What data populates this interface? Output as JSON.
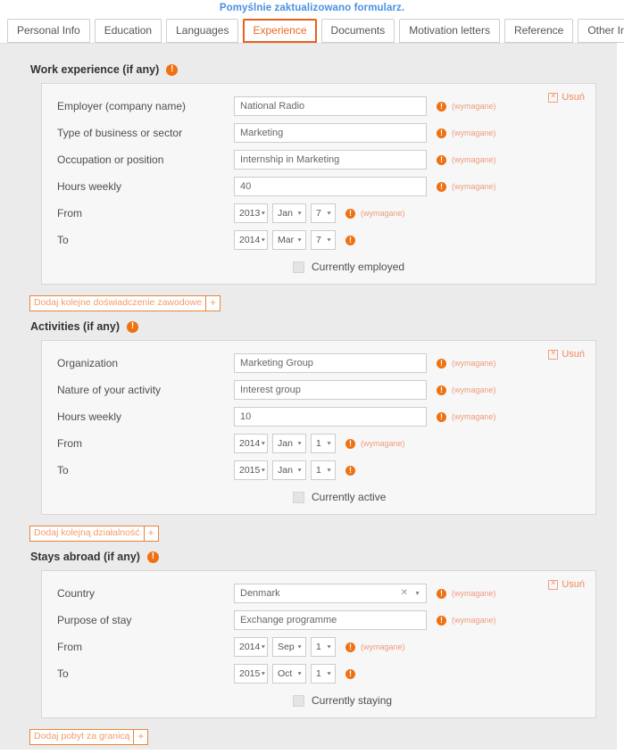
{
  "flash": {
    "message": "Pomyślnie zaktualizowano formularz."
  },
  "tabs": [
    {
      "label": "Personal Info",
      "active": false
    },
    {
      "label": "Education",
      "active": false
    },
    {
      "label": "Languages",
      "active": false
    },
    {
      "label": "Experience",
      "active": true
    },
    {
      "label": "Documents",
      "active": false
    },
    {
      "label": "Motivation letters",
      "active": false
    },
    {
      "label": "Reference",
      "active": false
    },
    {
      "label": "Other Info",
      "active": false
    }
  ],
  "common": {
    "required_text": "(wymagane)",
    "delete_label": "Usuń",
    "delete_icon": "close-box-icon",
    "info_icon": "info-icon",
    "caret_icon": "chevron-down-icon",
    "clear_icon": "clear-x-icon",
    "plus_icon": "plus-icon",
    "accent_color": "#ee7112",
    "flash_color": "#4a90e2",
    "required_color": "#f09a7a"
  },
  "sections": {
    "work": {
      "title": "Work experience (if any)",
      "fields": {
        "employer_label": "Employer (company name)",
        "employer_value": "National Radio",
        "sector_label": "Type of business or sector",
        "sector_value": "Marketing",
        "occupation_label": "Occupation or position",
        "occupation_value": "Internship in Marketing",
        "hours_label": "Hours weekly",
        "hours_value": "40",
        "from_label": "From",
        "from_year": "2013",
        "from_month": "Jan",
        "from_day": "7",
        "to_label": "To",
        "to_year": "2014",
        "to_month": "Mar",
        "to_day": "7",
        "checkbox_label": "Currently employed"
      },
      "add_button": "Dodaj kolejne doświadczenie zawodowe"
    },
    "activities": {
      "title": "Activities (if any)",
      "fields": {
        "organization_label": "Organization",
        "organization_value": "Marketing Group",
        "nature_label": "Nature of your activity",
        "nature_value": "Interest group",
        "hours_label": "Hours weekly",
        "hours_value": "10",
        "from_label": "From",
        "from_year": "2014",
        "from_month": "Jan",
        "from_day": "1",
        "to_label": "To",
        "to_year": "2015",
        "to_month": "Jan",
        "to_day": "1",
        "checkbox_label": "Currently active"
      },
      "add_button": "Dodaj kolejną działalność"
    },
    "stays": {
      "title": "Stays abroad (if any)",
      "fields": {
        "country_label": "Country",
        "country_value": "Denmark",
        "purpose_label": "Purpose of stay",
        "purpose_value": "Exchange programme",
        "from_label": "From",
        "from_year": "2014",
        "from_month": "Sep",
        "from_day": "1",
        "to_label": "To",
        "to_year": "2015",
        "to_month": "Oct",
        "to_day": "1",
        "checkbox_label": "Currently staying"
      },
      "add_button": "Dodaj pobyt za granicą"
    }
  }
}
